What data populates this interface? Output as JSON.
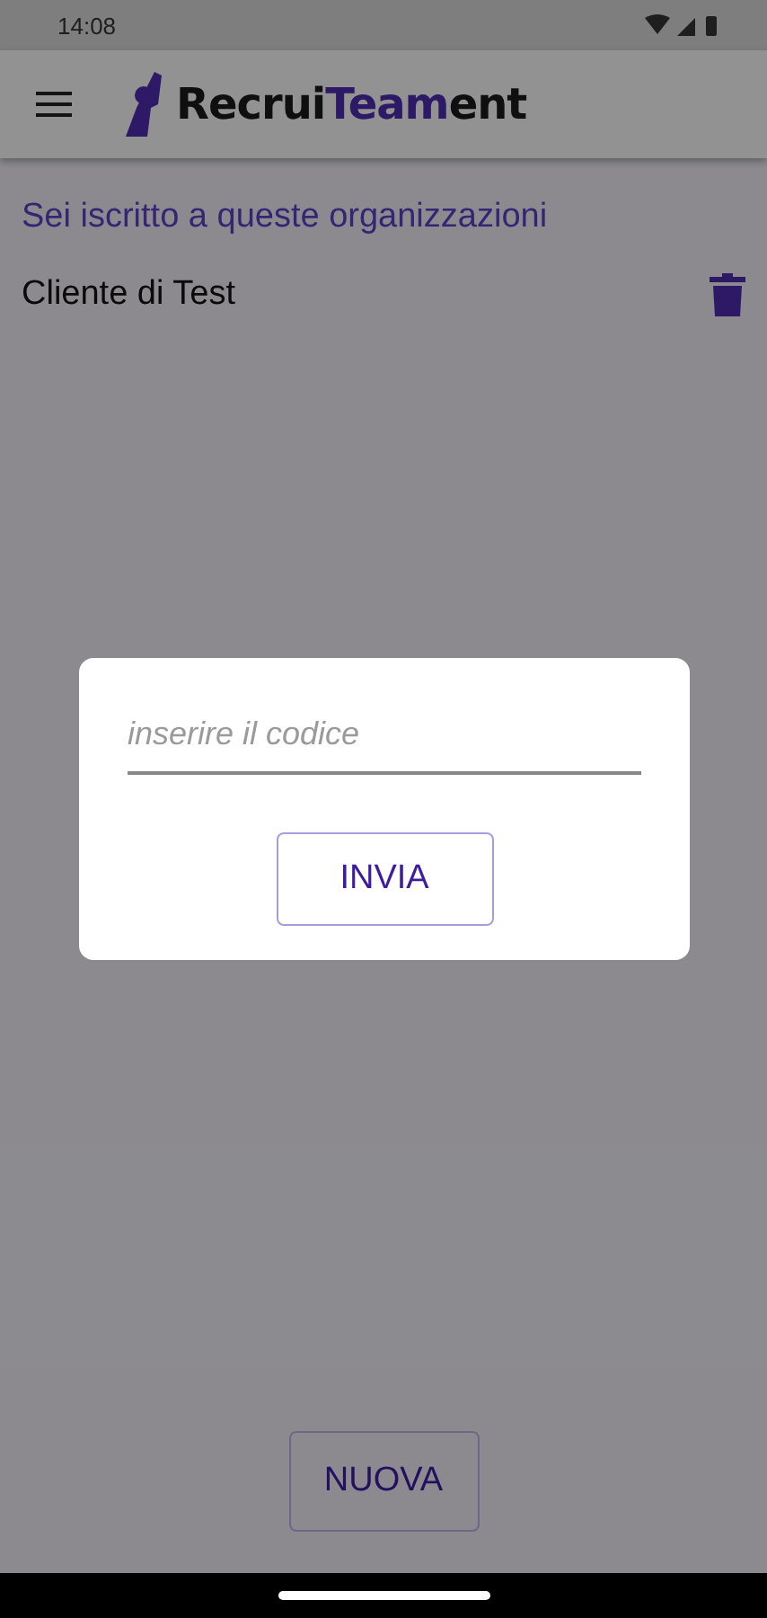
{
  "status_bar": {
    "time": "14:08"
  },
  "app_bar": {
    "logo": "Recrui**Team**ent"
  },
  "section_title": "Sei iscritto a queste organizzazioni",
  "organizations": [
    {
      "name": "Cliente di Test"
    }
  ],
  "new_button": "NUOVA",
  "dialog": {
    "placeholder": "inserire il codice",
    "button": "INVIA"
  }
}
